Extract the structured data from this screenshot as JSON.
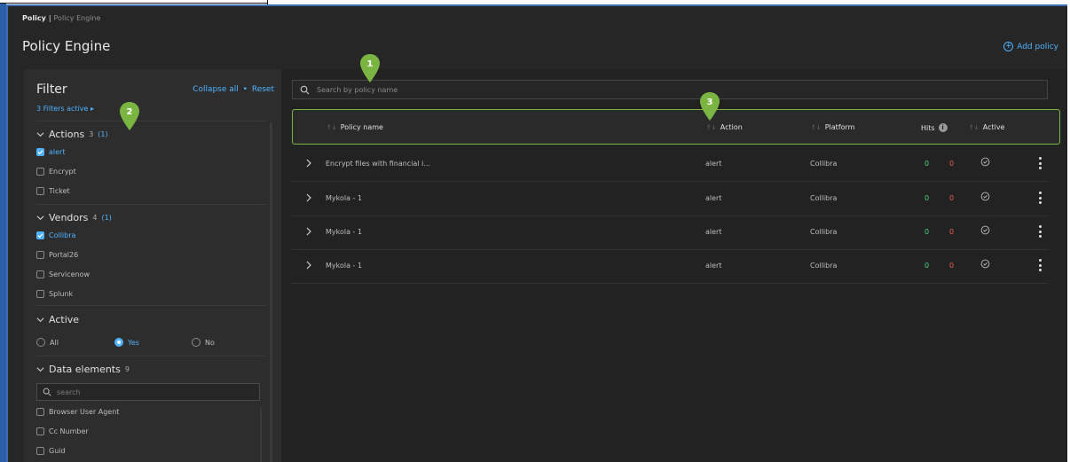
{
  "breadcrumb": {
    "root": "Policy",
    "separator": "|",
    "current": "Policy Engine"
  },
  "page_title": "Policy Engine",
  "add_policy_label": "Add policy",
  "filter": {
    "title": "Filter",
    "collapse_all": "Collapse all",
    "dot": "•",
    "reset": "Reset",
    "filters_active": "3 Filters active",
    "filters_active_caret": "▸",
    "sections": {
      "actions": {
        "title": "Actions",
        "count": "3",
        "selected": "(1)",
        "items": [
          {
            "label": "alert",
            "checked": true
          },
          {
            "label": "Encrypt",
            "checked": false
          },
          {
            "label": "Ticket",
            "checked": false
          }
        ]
      },
      "vendors": {
        "title": "Vendors",
        "count": "4",
        "selected": "(1)",
        "items": [
          {
            "label": "Collibra",
            "checked": true
          },
          {
            "label": "Portal26",
            "checked": false
          },
          {
            "label": "Servicenow",
            "checked": false
          },
          {
            "label": "Splunk",
            "checked": false
          }
        ]
      },
      "active": {
        "title": "Active",
        "options": [
          {
            "label": "All",
            "selected": false
          },
          {
            "label": "Yes",
            "selected": true
          },
          {
            "label": "No",
            "selected": false
          }
        ]
      },
      "data_elements": {
        "title": "Data elements",
        "count": "9",
        "search_placeholder": "search",
        "items": [
          {
            "label": "Browser User Agent"
          },
          {
            "label": "Cc Number"
          },
          {
            "label": "Guid"
          }
        ]
      }
    }
  },
  "search": {
    "placeholder": "Search by policy name"
  },
  "table": {
    "sort_glyph": "↑↓",
    "columns": {
      "policy_name": "Policy name",
      "action": "Action",
      "platform": "Platform",
      "hits": "Hits",
      "active": "Active"
    },
    "info_glyph": "i",
    "rows": [
      {
        "name": "Encrypt files with financial i...",
        "action": "alert",
        "platform": "Collibra",
        "hits_a": "0",
        "hits_b": "0"
      },
      {
        "name": "Mykola - 1",
        "action": "alert",
        "platform": "Collibra",
        "hits_a": "0",
        "hits_b": "0"
      },
      {
        "name": "Mykola - 1",
        "action": "alert",
        "platform": "Collibra",
        "hits_a": "0",
        "hits_b": "0"
      },
      {
        "name": "Mykola - 1",
        "action": "alert",
        "platform": "Collibra",
        "hits_a": "0",
        "hits_b": "0"
      }
    ]
  },
  "markers": [
    {
      "label": "1"
    },
    {
      "label": "2"
    },
    {
      "label": "3"
    }
  ],
  "colors": {
    "accent": "#4fb2ff",
    "marker": "#7ab541",
    "hits_positive": "#4fd67d",
    "hits_negative": "#ef5b5b",
    "background": "#262626"
  }
}
